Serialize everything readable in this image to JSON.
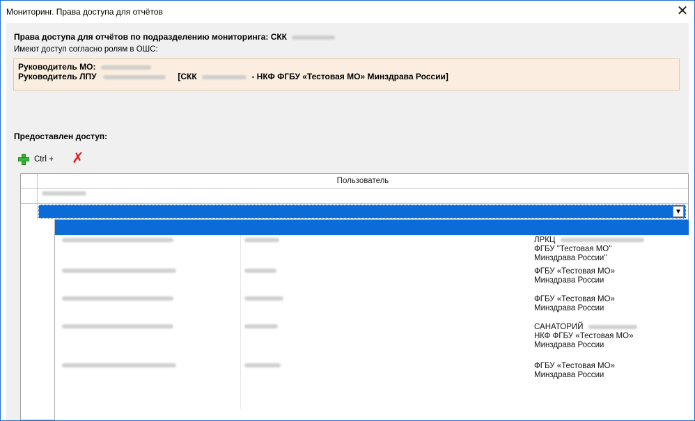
{
  "window": {
    "title": "Мониторинг. Права доступа для отчётов",
    "close_glyph": "✕"
  },
  "heading": {
    "prefix": "Права доступа для отчётов по подразделению мониторинга: СКК"
  },
  "subtext": "Имеют доступ согласно ролям в ОШС:",
  "roles": {
    "line1_label": "Руководитель МО:",
    "line2_label": "Руководитель ЛПУ",
    "line2_org_open": "[СКК",
    "line2_org_rest": "- НКФ ФГБУ «Тестовая МО» Минздрава России]"
  },
  "access_label": "Предоставлен доступ:",
  "toolbar": {
    "add_icon": "plus-icon",
    "ctrl_label": "Ctrl +",
    "delete_icon": "delete-icon"
  },
  "grid": {
    "column_header": "Пользователь",
    "combo_arrow": "▼"
  },
  "dropdown": {
    "rows": [
      {
        "org_line1": "ЛРКЦ",
        "org_line2": "ФГБУ \"Тестовая МО\"",
        "org_line3": "Минздрава России\""
      },
      {
        "org_line1": "ФГБУ «Тестовая МО»",
        "org_line2": "Минздрава России",
        "org_line3": ""
      },
      {
        "org_line1": "ФГБУ «Тестовая МО»",
        "org_line2": "Минздрава России",
        "org_line3": ""
      },
      {
        "org_line1": "САНАТОРИЙ",
        "org_line2": "НКФ ФГБУ «Тестовая МО»",
        "org_line3": "Минздрава России"
      },
      {
        "org_line1": "ФГБУ «Тестовая МО»",
        "org_line2": "Минздрава России",
        "org_line3": ""
      }
    ]
  },
  "colors": {
    "selection": "#0b6cd8",
    "roles_background": "#fbeee0",
    "delete_red": "#e02020",
    "add_green": "#3cb43c"
  }
}
